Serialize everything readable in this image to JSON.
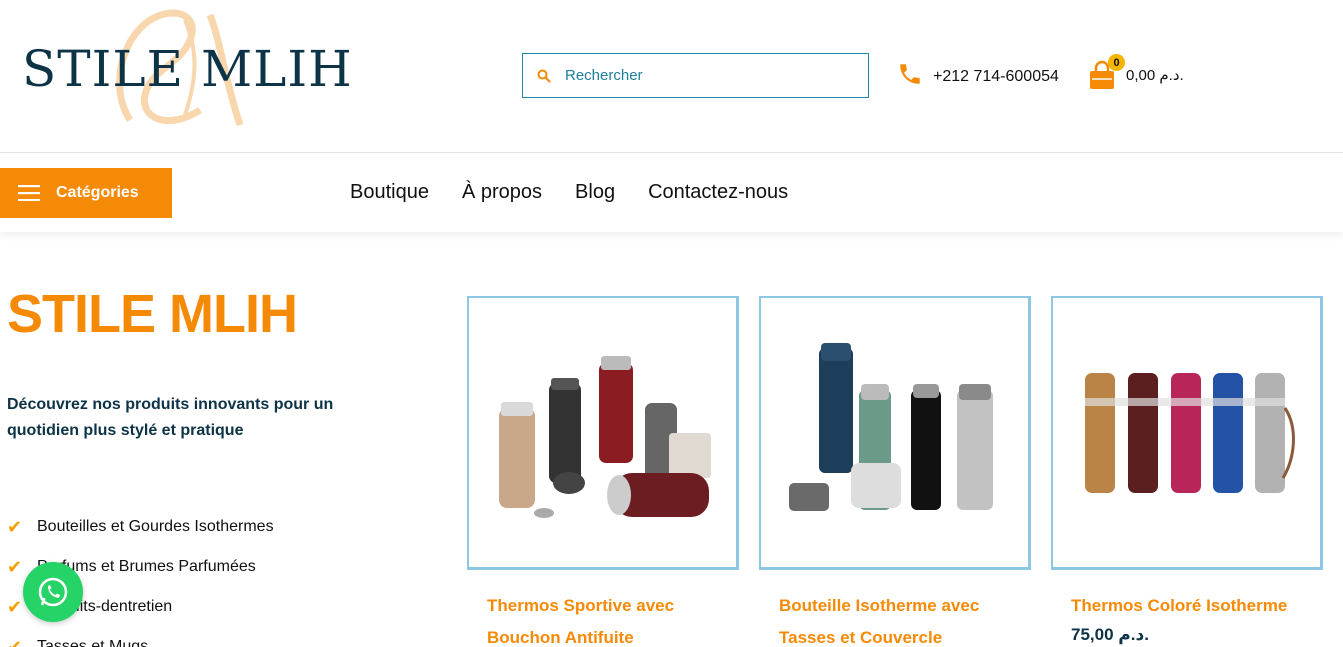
{
  "brand": {
    "logo_text": "STILE MLIH",
    "colors": {
      "accent": "#f58a07",
      "navy": "#0d3346",
      "card_border": "#8ec7e3",
      "whatsapp": "#25d366"
    }
  },
  "header": {
    "search": {
      "placeholder": "Rechercher"
    },
    "phone": "+212 714-600054",
    "cart": {
      "count": "0",
      "total": "0,00 د.م."
    }
  },
  "nav": {
    "categories_label": "Catégories",
    "links": [
      "Boutique",
      "À propos",
      "Blog",
      "Contactez-nous"
    ]
  },
  "hero": {
    "title": "STILE MLIH",
    "tagline": "Découvrez nos produits innovants pour un quotidien plus stylé et pratique",
    "features": [
      "Bouteilles et Gourdes Isothermes",
      "Parfums et Brumes Parfumées",
      "Produits-dentretien",
      "Tasses et Mugs"
    ]
  },
  "products": [
    {
      "title_line1": "Thermos Sportive avec",
      "title_line2": "Bouchon Antifuite",
      "price": ""
    },
    {
      "title_line1": "Bouteille Isotherme avec",
      "title_line2": "Tasses et Couvercle",
      "price": ""
    },
    {
      "title_line1": "Thermos Coloré Isotherme",
      "title_line2": "",
      "price": "75,00 د.م."
    }
  ],
  "icons": {
    "search": "search-icon",
    "phone": "phone-icon",
    "cart": "shopping-bag-icon",
    "menu": "hamburger-icon",
    "check": "check-icon",
    "whatsapp": "whatsapp-icon"
  }
}
